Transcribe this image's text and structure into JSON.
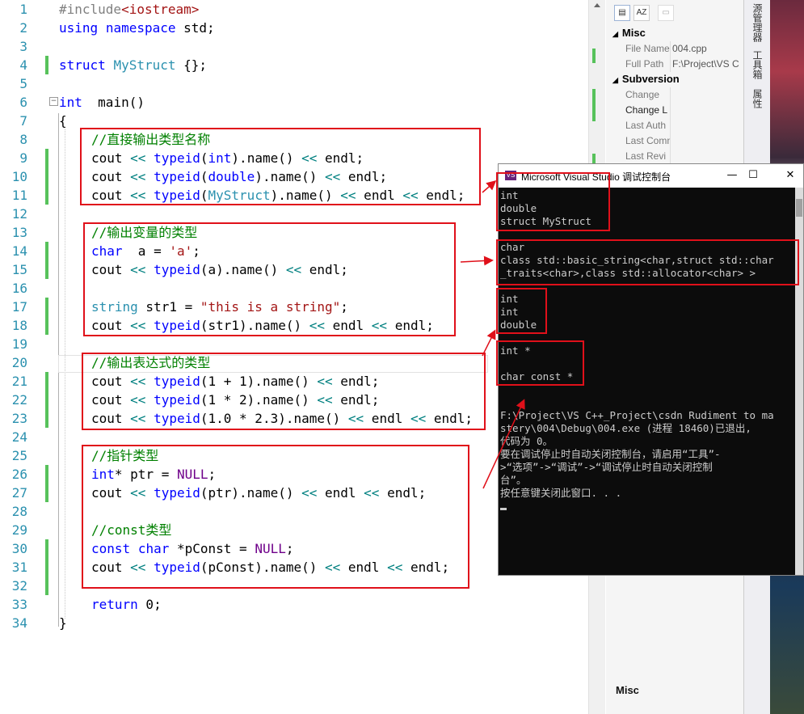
{
  "editor": {
    "line_numbers": [
      "1",
      "2",
      "3",
      "4",
      "5",
      "6",
      "7",
      "8",
      "9",
      "10",
      "11",
      "12",
      "13",
      "14",
      "15",
      "16",
      "17",
      "18",
      "19",
      "20",
      "21",
      "22",
      "23",
      "24",
      "25",
      "26",
      "27",
      "28",
      "29",
      "30",
      "31",
      "32",
      "33",
      "34"
    ],
    "lines": {
      "l1": [
        "#include",
        "<iostream>"
      ],
      "l2": [
        "using",
        " ",
        "namespace",
        " std;"
      ],
      "l4": [
        "struct",
        " ",
        "MyStruct",
        " {};"
      ],
      "l6": [
        "int",
        "  main()"
      ],
      "l7": [
        "{"
      ],
      "l8": [
        "//直接输出类型名称"
      ],
      "l9": [
        "cout ",
        "<<",
        " ",
        "typeid",
        "(",
        "int",
        ").name() ",
        "<<",
        " endl;"
      ],
      "l10": [
        "cout ",
        "<<",
        " ",
        "typeid",
        "(",
        "double",
        ").name() ",
        "<<",
        " endl;"
      ],
      "l11": [
        "cout ",
        "<<",
        " ",
        "typeid",
        "(",
        "MyStruct",
        ").name() ",
        "<<",
        " endl ",
        "<<",
        " endl;"
      ],
      "l13": [
        "//输出变量的类型"
      ],
      "l14": [
        "char",
        "  a = ",
        "'a'",
        ";"
      ],
      "l15": [
        "cout ",
        "<<",
        " ",
        "typeid",
        "(a).name() ",
        "<<",
        " endl;"
      ],
      "l17": [
        "string",
        " str1 = ",
        "\"this is a string\"",
        ";"
      ],
      "l18": [
        "cout ",
        "<<",
        " ",
        "typeid",
        "(str1).name() ",
        "<<",
        " endl ",
        "<<",
        " endl;"
      ],
      "l20": [
        "//输出表达式的类型"
      ],
      "l21": [
        "cout ",
        "<<",
        " ",
        "typeid",
        "(1 + 1).name() ",
        "<<",
        " endl;"
      ],
      "l22": [
        "cout ",
        "<<",
        " ",
        "typeid",
        "(1 * 2).name() ",
        "<<",
        " endl;"
      ],
      "l23": [
        "cout ",
        "<<",
        " ",
        "typeid",
        "(1.0 * 2.3).name() ",
        "<<",
        " endl ",
        "<<",
        " endl;"
      ],
      "l25": [
        "//指针类型"
      ],
      "l26": [
        "int",
        "* ptr = ",
        "NULL",
        ";"
      ],
      "l27": [
        "cout ",
        "<<",
        " ",
        "typeid",
        "(ptr).name() ",
        "<<",
        " endl ",
        "<<",
        " endl;"
      ],
      "l29": [
        "//const类型"
      ],
      "l30": [
        "const",
        " ",
        "char",
        " *pConst = ",
        "NULL",
        ";"
      ],
      "l31": [
        "cout ",
        "<<",
        " ",
        "typeid",
        "(pConst).name() ",
        "<<",
        " endl ",
        "<<",
        " endl;"
      ],
      "l33": [
        "return",
        " 0;"
      ],
      "l34": [
        "}"
      ]
    },
    "fold_marker": "−"
  },
  "properties": {
    "toolbar": [
      "categorized-icon",
      "alphabetical-icon",
      "property-pages-icon"
    ],
    "toolbar_glyphs": [
      "▤",
      "AZ",
      "▭"
    ],
    "categories": [
      {
        "name": "Misc",
        "rows": [
          {
            "label": "File Name",
            "value": "004.cpp"
          },
          {
            "label": "Full Path",
            "value": "F:\\Project\\VS C"
          }
        ]
      },
      {
        "name": "Subversion",
        "rows": [
          {
            "label": "Change",
            "value": ""
          },
          {
            "label": "Change L",
            "value": ""
          },
          {
            "label": "Last Auth",
            "value": ""
          },
          {
            "label": "Last Comm",
            "value": ""
          },
          {
            "label": "Last Revi",
            "value": ""
          }
        ]
      }
    ],
    "footer": "Misc",
    "expand_glyph": "◢"
  },
  "side_tabs": [
    "源管理器",
    "工具箱",
    "属性"
  ],
  "console": {
    "icon_text": "VS",
    "title": "Microsoft Visual Studio 调试控制台",
    "buttons": {
      "minimize": "—",
      "maximize": "☐",
      "close": "✕"
    },
    "lines": [
      "int",
      "double",
      "struct MyStruct",
      "",
      "char",
      "class std::basic_string<char,struct std::char",
      "_traits<char>,class std::allocator<char> >",
      "",
      "int",
      "int",
      "double",
      "",
      "int *",
      "",
      "char const *",
      "",
      "",
      "F:\\Project\\VS C++_Project\\csdn Rudiment to ma",
      "stery\\004\\Debug\\004.exe (进程 18460)已退出,",
      "代码为 0。",
      "要在调试停止时自动关闭控制台，请启用“工具”-",
      ">“选项”->“调试”->“调试停止时自动关闭控制",
      "台”。",
      "按任意键关闭此窗口. . ."
    ]
  }
}
